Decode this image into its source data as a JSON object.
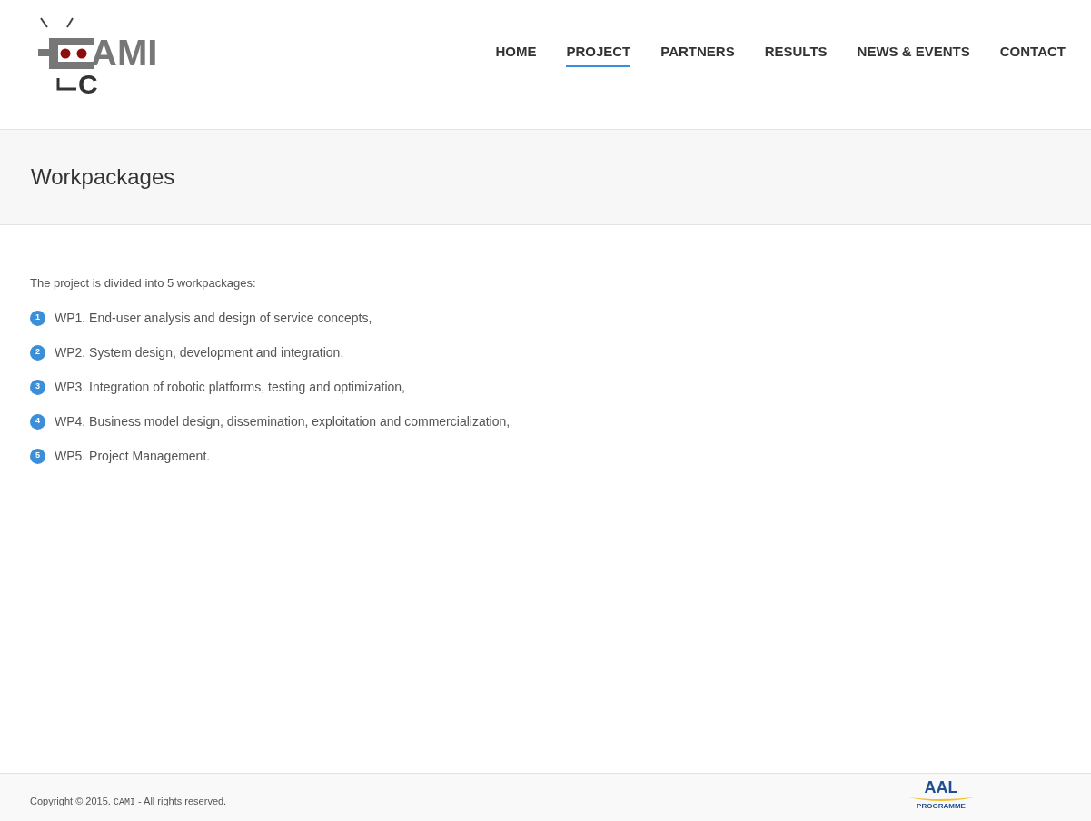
{
  "logo": {
    "letters": "AMI",
    "lower_letter": "C"
  },
  "nav": [
    {
      "label": "HOME",
      "selected": false
    },
    {
      "label": "PROJECT",
      "selected": true
    },
    {
      "label": "PARTNERS",
      "selected": false
    },
    {
      "label": "RESULTS",
      "selected": false
    },
    {
      "label": "NEWS & EVENTS",
      "selected": false
    },
    {
      "label": "CONTACT",
      "selected": false
    }
  ],
  "page_title": "Workpackages",
  "intro": "The project is divided into 5 workpackages:",
  "workpackages": [
    {
      "number": "1",
      "text": "WP1. End-user analysis and design of service concepts,"
    },
    {
      "number": "2",
      "text": "WP2. System design, development and integration,"
    },
    {
      "number": "3",
      "text": "WP3. Integration of robotic platforms, testing and optimization,"
    },
    {
      "number": "4",
      "text": "WP4. Business model design, dissemination, exploitation and commercialization,"
    },
    {
      "number": "5",
      "text": "WP5. Project Management."
    }
  ],
  "footer": {
    "copyright_prefix": "Copyright © 2015.",
    "copyright_brand": "CAMI",
    "copyright_suffix": "- All rights reserved.",
    "partner_logo": {
      "title": "AAL",
      "subtitle": "PROGRAMME"
    }
  }
}
